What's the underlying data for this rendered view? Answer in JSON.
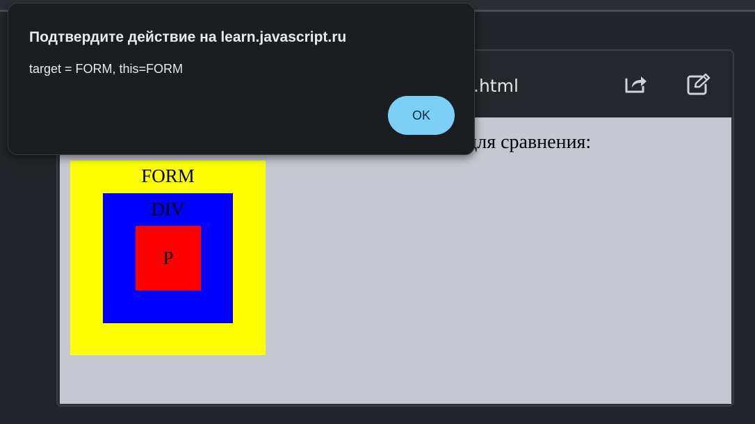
{
  "dialog": {
    "title": "Подтвердите действие на learn.javascript.ru",
    "message": "target = FORM, this=FORM",
    "ok_label": "OK"
  },
  "viewer": {
    "file_name": ".html",
    "share_icon": "share-icon",
    "edit_icon": "edit-icon"
  },
  "demo": {
    "text": "для сравнения:",
    "form_label": "FORM",
    "div_label": "DIV",
    "p_label": "P",
    "colors": {
      "form": "#ffff00",
      "div": "#0000ff",
      "p": "#ff0000",
      "background": "#c6c8d1"
    }
  }
}
